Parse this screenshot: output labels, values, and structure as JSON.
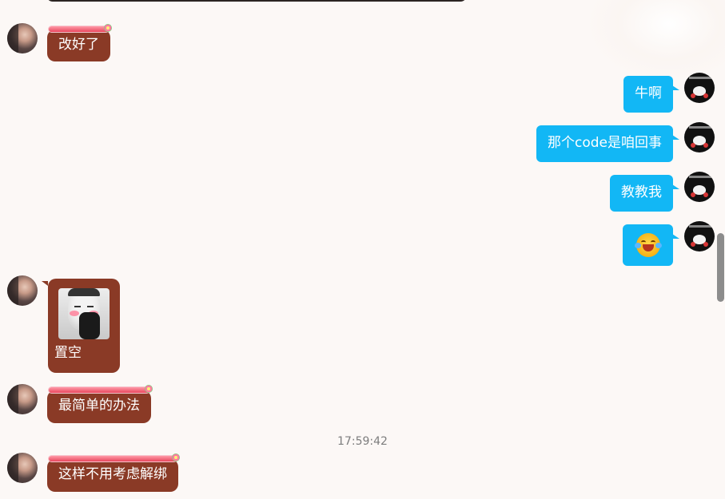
{
  "messages": [
    {
      "id": "m1",
      "side": "left",
      "text": "改好了"
    },
    {
      "id": "m2",
      "side": "right",
      "text": "牛啊"
    },
    {
      "id": "m3",
      "side": "right",
      "text": "那个code是咱回事"
    },
    {
      "id": "m4",
      "side": "right",
      "text": "教教我"
    },
    {
      "id": "m5",
      "side": "right",
      "emoji": "laughing-crying-emoji"
    },
    {
      "id": "m6",
      "side": "left",
      "sticker": "face-sticker",
      "text": "置空"
    },
    {
      "id": "m7",
      "side": "left",
      "text": "最简单的办法"
    },
    {
      "id": "m8",
      "side": "left",
      "text": "这样不用考虑解绑"
    }
  ],
  "timestamp": "17:59:42",
  "colors": {
    "background": "#fcf8f6",
    "left_bubble": "#8a3a26",
    "right_bubble": "#12b7f5",
    "timestamp_text": "#7d7d7d"
  },
  "icons": {
    "left_avatar": "contact-avatar",
    "right_avatar": "self-avatar"
  }
}
